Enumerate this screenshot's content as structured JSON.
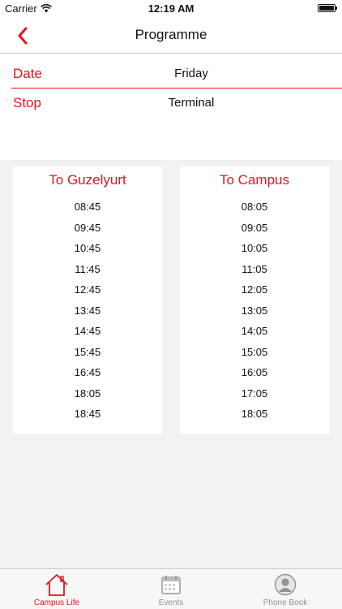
{
  "status_bar": {
    "carrier": "Carrier",
    "time": "12:19 AM"
  },
  "nav": {
    "title": "Programme",
    "back_icon": "chevron-left-icon"
  },
  "form": {
    "date_label": "Date",
    "date_value": "Friday",
    "stop_label": "Stop",
    "stop_value": "Terminal"
  },
  "schedules": [
    {
      "title": "To Guzelyurt",
      "times": [
        "08:45",
        "09:45",
        "10:45",
        "11:45",
        "12:45",
        "13:45",
        "14:45",
        "15:45",
        "16:45",
        "18:05",
        "18:45"
      ]
    },
    {
      "title": "To Campus",
      "times": [
        "08:05",
        "09:05",
        "10:05",
        "11:05",
        "12:05",
        "13:05",
        "14:05",
        "15:05",
        "16:05",
        "17:05",
        "18:05"
      ]
    }
  ],
  "tabs": [
    {
      "label": "Campus Life",
      "icon": "house-icon",
      "active": true
    },
    {
      "label": "Events",
      "icon": "calendar-icon",
      "active": false
    },
    {
      "label": "Phone Book",
      "icon": "person-icon",
      "active": false
    }
  ],
  "colors": {
    "accent": "#e0161e",
    "inactive": "#929292",
    "background": "#f2f2f2"
  }
}
